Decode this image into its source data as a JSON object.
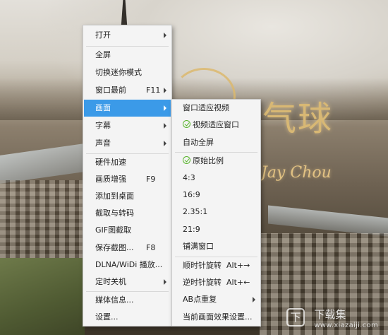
{
  "video": {
    "title_art": "气球",
    "title_sub": "Jay Chou",
    "watermark_logo": "下",
    "watermark_text": "下载集",
    "watermark_url": "www.xiazaiji.com"
  },
  "main_menu": {
    "items": [
      {
        "label": "打开"
      },
      {
        "label": "全屏"
      },
      {
        "label": "切换迷你模式"
      },
      {
        "label": "窗口最前",
        "shortcut": "F11"
      },
      {
        "label": "画面"
      },
      {
        "label": "字幕"
      },
      {
        "label": "声音"
      },
      {
        "label": "硬件加速"
      },
      {
        "label": "画质增强",
        "shortcut": "F9"
      },
      {
        "label": "添加到桌面"
      },
      {
        "label": "截取与转码"
      },
      {
        "label": "GIF图截取"
      },
      {
        "label": "保存截图...",
        "shortcut": "F8"
      },
      {
        "label": "DLNA/WiDi 播放..."
      },
      {
        "label": "定时关机"
      },
      {
        "label": "媒体信息..."
      },
      {
        "label": "设置..."
      }
    ],
    "active": "画面"
  },
  "sub_menu": {
    "items": [
      {
        "label": "窗口适应视频"
      },
      {
        "label": "视频适应窗口",
        "checked": true
      },
      {
        "label": "自动全屏"
      },
      {
        "label": "原始比例",
        "checked": true
      },
      {
        "label": "4:3"
      },
      {
        "label": "16:9"
      },
      {
        "label": "2.35:1"
      },
      {
        "label": "21:9"
      },
      {
        "label": "铺满窗口"
      },
      {
        "label": "顺时针旋转",
        "shortcut": "Alt+→"
      },
      {
        "label": "逆时针旋转",
        "shortcut": "Alt+←"
      },
      {
        "label": "AB点重复"
      },
      {
        "label": "当前画面效果设置..."
      }
    ]
  },
  "colors": {
    "menu_bg": "#f4f4f4",
    "highlight": "#3b9ae8",
    "check": "#5ab52e"
  }
}
